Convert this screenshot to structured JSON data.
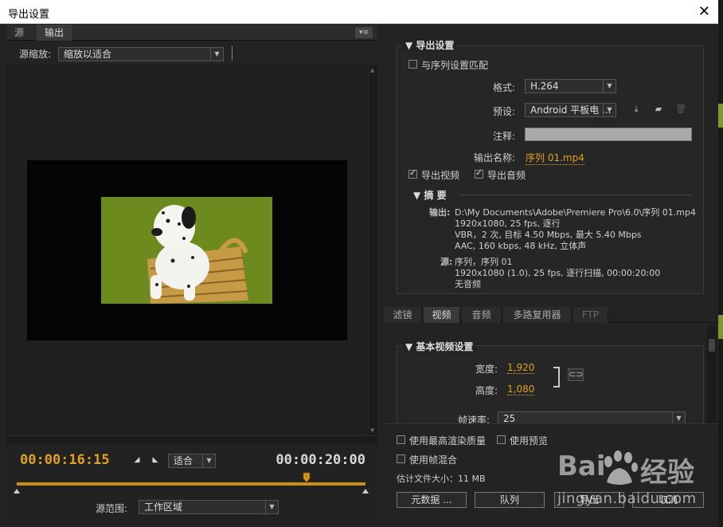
{
  "window": {
    "title": "导出设置",
    "close_glyph": "✕"
  },
  "left": {
    "tabs": [
      {
        "label": "源"
      },
      {
        "label": "输出"
      }
    ],
    "panel_menu_icon": "panel-menu-icon",
    "zoom": {
      "label": "源缩放:",
      "value": "缩放以适合"
    },
    "timecode_current": "00:00:16:15",
    "timecode_duration": "00:00:20:00",
    "fit": {
      "value": "适合"
    },
    "range": {
      "label": "源范围:",
      "value": "工作区域"
    },
    "playhead_fraction": 0.83
  },
  "export": {
    "section_title": "导出设置",
    "match_sequence": {
      "label": "与序列设置匹配",
      "checked": false
    },
    "format": {
      "label": "格式:",
      "value": "H.264"
    },
    "preset": {
      "label": "预设:",
      "value": "Android 平板电 ..."
    },
    "comment": {
      "label": "注释:",
      "value": ""
    },
    "output_name": {
      "label": "输出名称:",
      "value": "序列 01.mp4"
    },
    "export_video": {
      "label": "导出视频",
      "checked": true
    },
    "export_audio": {
      "label": "导出音频",
      "checked": true
    },
    "summary": {
      "title": "摘 要",
      "output_label": "输出:",
      "output_lines": [
        "D:\\My Documents\\Adobe\\Premiere Pro\\6.0\\序列 01.mp4",
        "1920x1080, 25 fps, 逐行",
        "VBR，2 次, 目标 4.50 Mbps, 最大 5.40 Mbps",
        "AAC, 160 kbps, 48 kHz, 立体声"
      ],
      "source_label": "源:",
      "source_lines": [
        "序列，序列 01",
        "1920x1080 (1.0), 25 fps, 逐行扫描, 00:00:20:00",
        "无音频"
      ]
    }
  },
  "rtabs": [
    {
      "label": "滤镜"
    },
    {
      "label": "视频"
    },
    {
      "label": "音频"
    },
    {
      "label": "多路复用器"
    },
    {
      "label": "FTP"
    }
  ],
  "video": {
    "section_title": "基本视频设置",
    "width": {
      "label": "宽度:",
      "value": "1,920"
    },
    "height": {
      "label": "高度:",
      "value": "1,080"
    },
    "framerate": {
      "label": "帧速率:",
      "value": "25"
    }
  },
  "bottom": {
    "max_quality": {
      "label": "使用最高渲染质量",
      "checked": false
    },
    "use_preview": {
      "label": "使用预览",
      "checked": false
    },
    "frame_blend": {
      "label": "使用帧混合",
      "checked": false
    },
    "filesize": "估计文件大小：11 MB",
    "metadata_button": "元数据 ...",
    "queue_button": "队列",
    "export_button": "导出",
    "cancel_button": "取消"
  },
  "watermark": {
    "logo_left": "Bai",
    "logo_right": "经验",
    "url": "jingyan.baidu.com"
  },
  "colors": {
    "accent": "#e0a21a",
    "image_bg": "#6d8a1e",
    "panel": "#232323"
  }
}
